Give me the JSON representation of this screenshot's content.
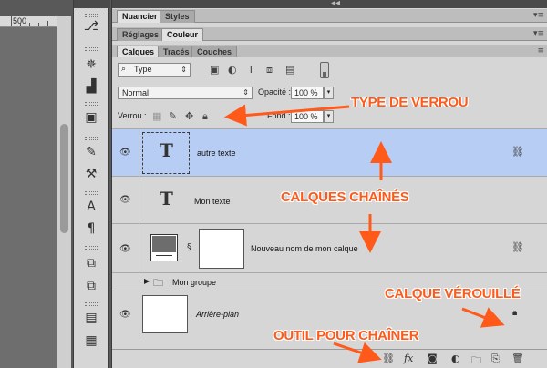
{
  "ruler": {
    "value": "500"
  },
  "panels": {
    "top_tabs": [
      {
        "label": "Nuancier"
      },
      {
        "label": "Styles"
      }
    ],
    "mid_tabs": [
      {
        "label": "Réglages"
      },
      {
        "label": "Couleur"
      }
    ],
    "layer_tabs": [
      {
        "label": "Calques"
      },
      {
        "label": "Tracés"
      },
      {
        "label": "Couches"
      }
    ]
  },
  "layers_panel": {
    "filter_value": "Type",
    "blend_mode": "Normal",
    "opacity_label": "Opacité :",
    "opacity_value": "100 %",
    "lock_label": "Verrou :",
    "fill_label": "Fond :",
    "fill_value": "100 %",
    "layers": [
      {
        "name": "autre texte",
        "kind": "text",
        "selected": true,
        "linked": true
      },
      {
        "name": "Mon texte",
        "kind": "text",
        "selected": false,
        "linked": false
      },
      {
        "name": "Nouveau nom de mon calque",
        "kind": "raster",
        "selected": false,
        "linked": true
      },
      {
        "name": "Mon groupe",
        "kind": "group",
        "selected": false,
        "linked": false
      },
      {
        "name": "Arrière-plan",
        "kind": "background",
        "selected": false,
        "locked": true
      }
    ]
  },
  "annotations": {
    "lock_type": "TYPE DE VERROU",
    "linked_layers": "CALQUES CHAÎNÉS",
    "locked_layer": "CALQUE VÉROUILLÉ",
    "link_tool": "OUTIL POUR CHAÎNER"
  },
  "colors": {
    "annotation": "#ff5a1a",
    "selected_layer": "#b8cdf3"
  },
  "icons": {
    "eye": "eye-icon",
    "link": "link-icon",
    "lock": "lock-icon",
    "fx": "fx-icon"
  }
}
